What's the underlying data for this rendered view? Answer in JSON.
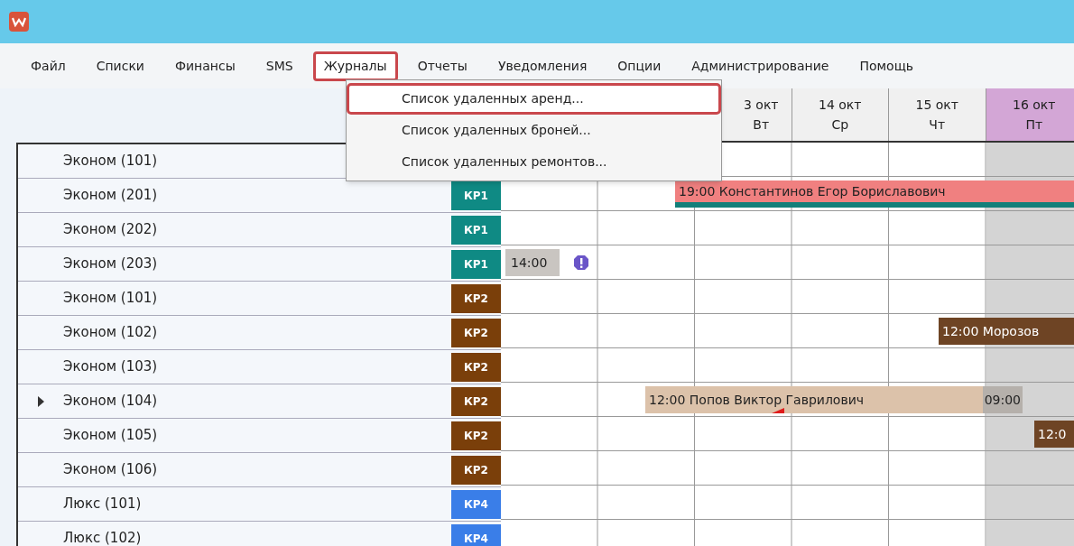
{
  "menu": [
    {
      "label": "Файл",
      "selected": false
    },
    {
      "label": "Списки",
      "selected": false
    },
    {
      "label": "Финансы",
      "selected": false
    },
    {
      "label": "SMS",
      "selected": false
    },
    {
      "label": "Журналы",
      "selected": true
    },
    {
      "label": "Отчеты",
      "selected": false
    },
    {
      "label": "Уведомления",
      "selected": false
    },
    {
      "label": "Опции",
      "selected": false
    },
    {
      "label": "Администрирование",
      "selected": false
    },
    {
      "label": "Помощь",
      "selected": false
    }
  ],
  "dropdown": [
    {
      "label": "Список удаленных аренд...",
      "selected": true
    },
    {
      "label": "Список удаленных броней...",
      "selected": false
    },
    {
      "label": "Список удаленных ремонтов...",
      "selected": false
    }
  ],
  "days": [
    {
      "date": "3 окт",
      "weekday": "Вт",
      "selected": false
    },
    {
      "date": "14 окт",
      "weekday": "Ср",
      "selected": false
    },
    {
      "date": "15 окт",
      "weekday": "Чт",
      "selected": false
    },
    {
      "date": "16 окт",
      "weekday": "Пт",
      "selected": true
    }
  ],
  "rows": [
    {
      "name": "Эконом (101)",
      "current": false
    },
    {
      "name": "Эконом (201)",
      "badge": "КР1",
      "color": "#0f8a84",
      "current": false
    },
    {
      "name": "Эконом (202)",
      "badge": "КР1",
      "color": "#0f8a84",
      "current": false
    },
    {
      "name": "Эконом (203)",
      "badge": "КР1",
      "color": "#0f8a84",
      "current": false
    },
    {
      "name": "Эконом (101)",
      "badge": "КР2",
      "color": "#7a3f0a",
      "current": false
    },
    {
      "name": "Эконом (102)",
      "badge": "КР2",
      "color": "#7a3f0a",
      "current": false
    },
    {
      "name": "Эконом (103)",
      "badge": "КР2",
      "color": "#7a3f0a",
      "current": false
    },
    {
      "name": "Эконом (104)",
      "badge": "КР2",
      "color": "#7a3f0a",
      "current": true
    },
    {
      "name": "Эконом (105)",
      "badge": "КР2",
      "color": "#7a3f0a",
      "current": false
    },
    {
      "name": "Эконом (106)",
      "badge": "КР2",
      "color": "#7a3f0a",
      "current": false
    },
    {
      "name": "Люкс (101)",
      "badge": "КР4",
      "color": "#3a7ee8",
      "current": false
    },
    {
      "name": "Люкс (102)",
      "badge": "КР4",
      "color": "#3a7ee8",
      "current": false
    }
  ],
  "bookings": [
    {
      "kind": "rental",
      "text": "19:00 Константинов Егор Бориславович",
      "color": "#f08080"
    },
    {
      "kind": "pending",
      "text": "14:00",
      "color": "#c9c5c1"
    },
    {
      "kind": "rental",
      "text": "12:00 Морозов",
      "color": "#6e4424"
    },
    {
      "kind": "rental",
      "text": "12:00 Попов Виктор Гаврилович",
      "end": "09:00",
      "color": "#dcc2aa"
    },
    {
      "kind": "rental",
      "text": "12:0",
      "color": "#6e4424"
    }
  ]
}
